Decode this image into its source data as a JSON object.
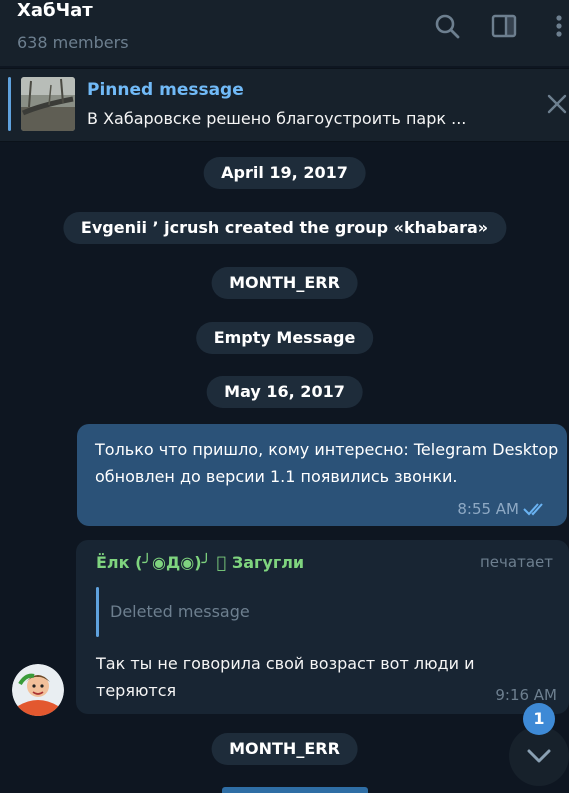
{
  "header": {
    "title": "ХабЧат",
    "subtitle": "638 members",
    "icons": [
      "search-icon",
      "sidebar-toggle-icon",
      "more-vertical-icon"
    ]
  },
  "pinned": {
    "title": "Pinned message",
    "text": "В Хабаровске решено благоустроить парк ...",
    "icons": [
      "pinned-thumbnail",
      "close-icon"
    ]
  },
  "services": [
    {
      "text": "April 19, 2017"
    },
    {
      "text": "Evgenii ’ jcrush created the group «khabara»"
    },
    {
      "text": "MONTH_ERR"
    },
    {
      "text": "Empty Message"
    },
    {
      "text": "May 16, 2017"
    },
    {
      "text": "MONTH_ERR"
    }
  ],
  "outgoing": {
    "text": "Только что пришло, кому интересно: Telegram Desktop обновлен до версии 1.1 появились звонки.",
    "time": "8:55 AM",
    "status_icon": "double-check-icon"
  },
  "incoming": {
    "sender": "Ёлк (╯◉Д◉)╯ ⃝ Загугли",
    "status": "печатает",
    "reply": "Deleted message",
    "text": "Так ты не говорила свой возраст вот люди и теряются",
    "time": "9:16 AM"
  },
  "scroll": {
    "unread": "1",
    "icon": "chevron-down-icon"
  },
  "colors": {
    "background": "#0e1621",
    "header": "#17212b",
    "outgoing_bubble": "#2b5278",
    "incoming_bubble": "#182533",
    "accent": "#5fa2de",
    "sender_name": "#7fd47f"
  }
}
